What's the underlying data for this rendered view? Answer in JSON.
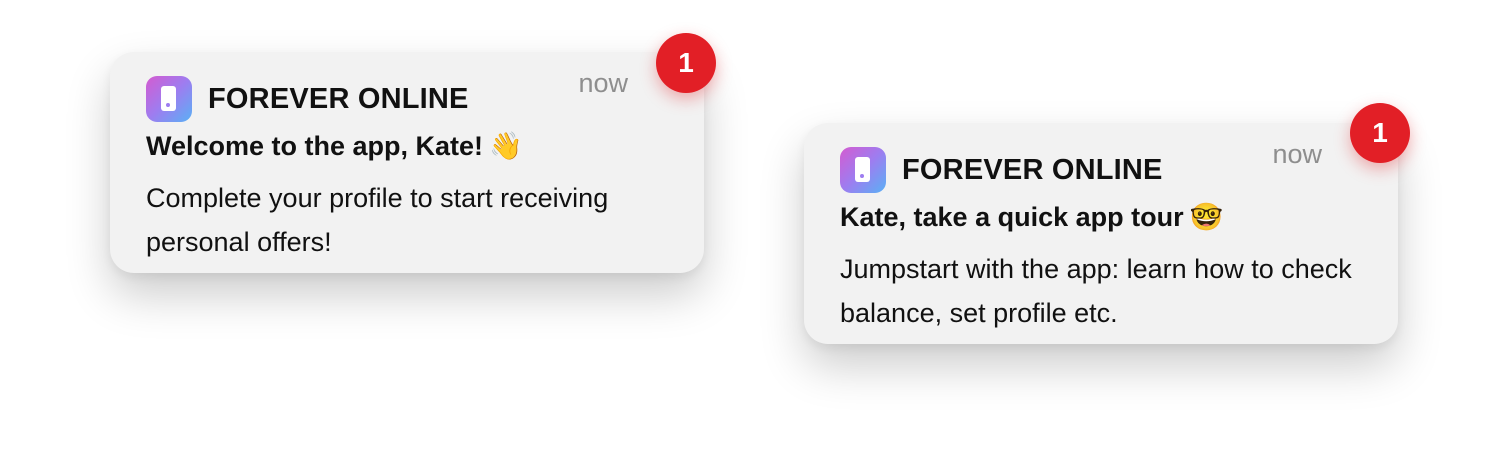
{
  "notifications": [
    {
      "app_name": "FOREVER ONLINE",
      "time": "now",
      "title": "Welcome to the app, Kate!",
      "title_emoji": "👋",
      "body": "Complete your profile to start receiving personal offers!",
      "badge_count": "1",
      "icon": "phone-icon"
    },
    {
      "app_name": "FOREVER ONLINE",
      "time": "now",
      "title": "Kate, take a quick app tour",
      "title_emoji": "🤓",
      "body": "Jumpstart with the app: learn how to check balance, set profile etc.",
      "badge_count": "1",
      "icon": "phone-icon"
    }
  ],
  "colors": {
    "card_background": "#f2f2f2",
    "badge": "#e21f26",
    "time_text": "#8e8e8e",
    "icon_gradient": [
      "#d45bd0",
      "#9d7df0",
      "#5ab0f5"
    ]
  }
}
